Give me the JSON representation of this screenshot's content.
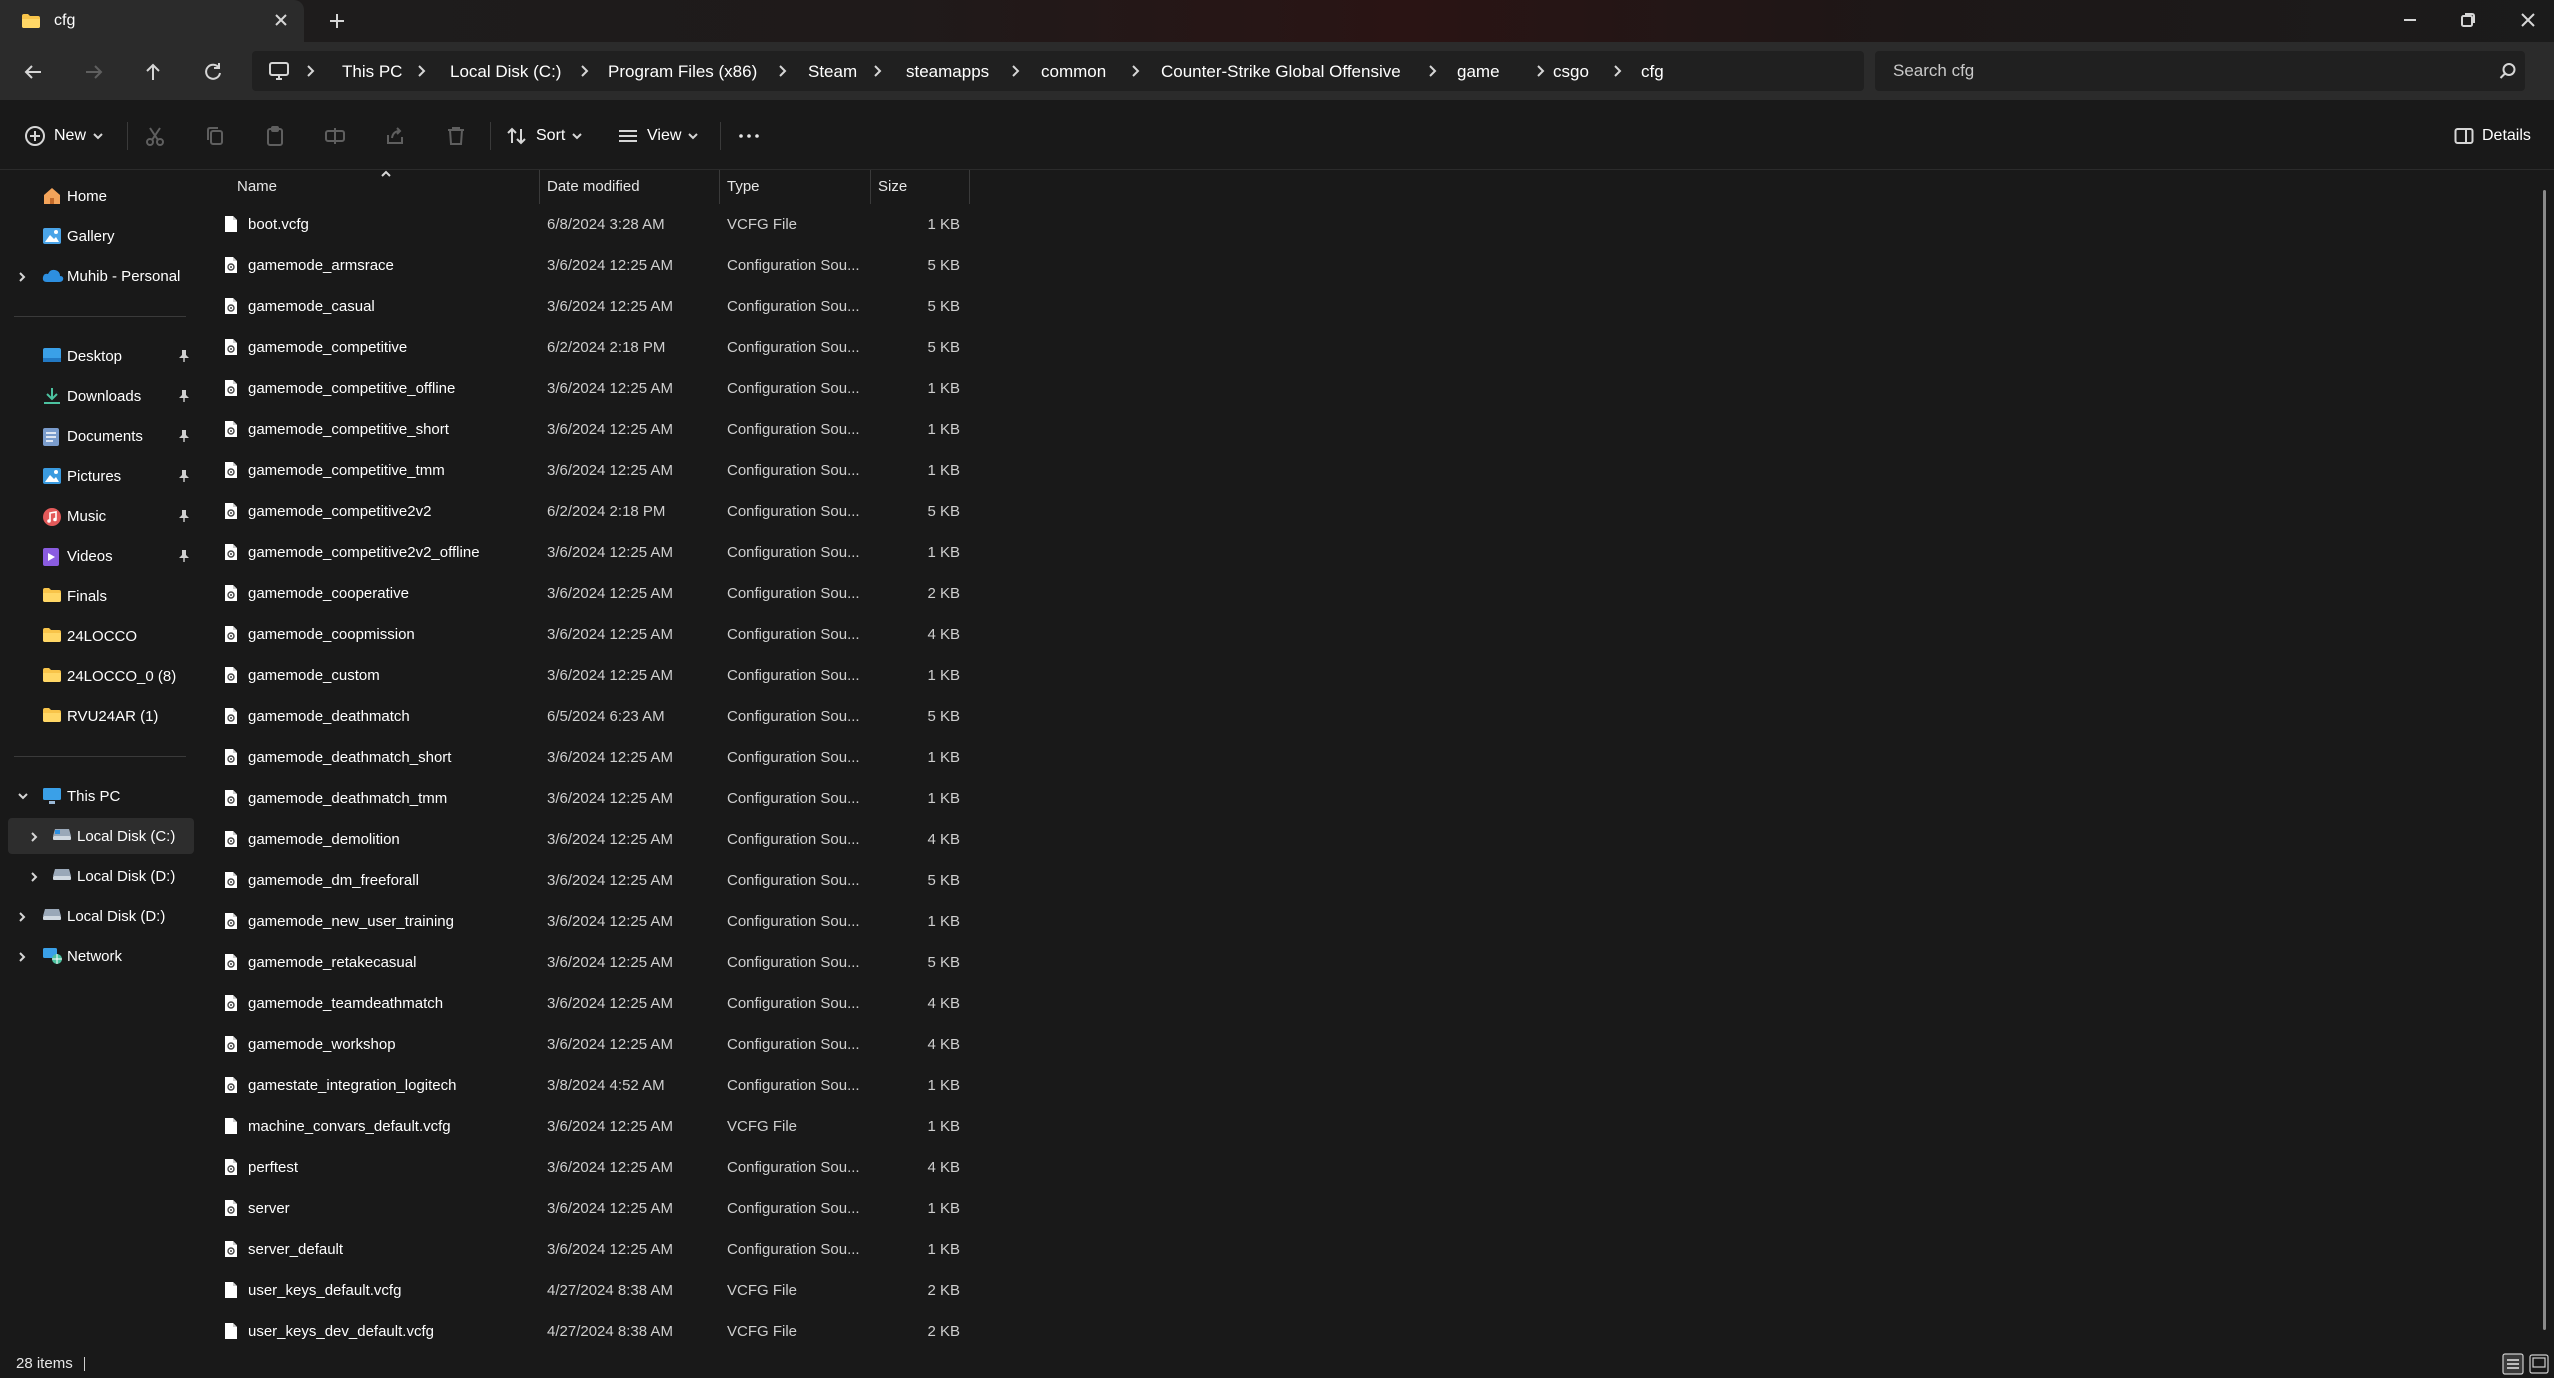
{
  "window": {
    "tab_title": "cfg",
    "tab_icon": "folder-icon",
    "accent_folder": "#f8c44a"
  },
  "address": {
    "crumbs": [
      "This PC",
      "Local Disk (C:)",
      "Program Files (x86)",
      "Steam",
      "steamapps",
      "common",
      "Counter-Strike Global Offensive",
      "game",
      "csgo",
      "cfg"
    ]
  },
  "search": {
    "placeholder": "Search cfg"
  },
  "commandbar": {
    "new_label": "New",
    "sort_label": "Sort",
    "view_label": "View",
    "details_label": "Details"
  },
  "sidebar": {
    "home": "Home",
    "gallery": "Gallery",
    "onedrive": "Muhib - Personal",
    "quick": [
      "Desktop",
      "Downloads",
      "Documents",
      "Pictures",
      "Music",
      "Videos",
      "Finals",
      "24LOCCO",
      "24LOCCO_0 (8)",
      "RVU24AR (1)"
    ],
    "thispc": "This PC",
    "disk_c": "Local Disk (C:)",
    "disk_d_sub": "Local Disk (D:)",
    "disk_d": "Local Disk (D:)",
    "network": "Network"
  },
  "columns": {
    "name": "Name",
    "date": "Date modified",
    "type": "Type",
    "size": "Size"
  },
  "files": [
    {
      "name": "boot.vcfg",
      "date": "6/8/2024 3:28 AM",
      "type": "VCFG File",
      "size": "1 KB",
      "icon": "file-icon"
    },
    {
      "name": "gamemode_armsrace",
      "date": "3/6/2024 12:25 AM",
      "type": "Configuration Sou...",
      "size": "5 KB",
      "icon": "config-file-icon"
    },
    {
      "name": "gamemode_casual",
      "date": "3/6/2024 12:25 AM",
      "type": "Configuration Sou...",
      "size": "5 KB",
      "icon": "config-file-icon"
    },
    {
      "name": "gamemode_competitive",
      "date": "6/2/2024 2:18 PM",
      "type": "Configuration Sou...",
      "size": "5 KB",
      "icon": "config-file-icon"
    },
    {
      "name": "gamemode_competitive_offline",
      "date": "3/6/2024 12:25 AM",
      "type": "Configuration Sou...",
      "size": "1 KB",
      "icon": "config-file-icon"
    },
    {
      "name": "gamemode_competitive_short",
      "date": "3/6/2024 12:25 AM",
      "type": "Configuration Sou...",
      "size": "1 KB",
      "icon": "config-file-icon"
    },
    {
      "name": "gamemode_competitive_tmm",
      "date": "3/6/2024 12:25 AM",
      "type": "Configuration Sou...",
      "size": "1 KB",
      "icon": "config-file-icon"
    },
    {
      "name": "gamemode_competitive2v2",
      "date": "6/2/2024 2:18 PM",
      "type": "Configuration Sou...",
      "size": "5 KB",
      "icon": "config-file-icon"
    },
    {
      "name": "gamemode_competitive2v2_offline",
      "date": "3/6/2024 12:25 AM",
      "type": "Configuration Sou...",
      "size": "1 KB",
      "icon": "config-file-icon"
    },
    {
      "name": "gamemode_cooperative",
      "date": "3/6/2024 12:25 AM",
      "type": "Configuration Sou...",
      "size": "2 KB",
      "icon": "config-file-icon"
    },
    {
      "name": "gamemode_coopmission",
      "date": "3/6/2024 12:25 AM",
      "type": "Configuration Sou...",
      "size": "4 KB",
      "icon": "config-file-icon"
    },
    {
      "name": "gamemode_custom",
      "date": "3/6/2024 12:25 AM",
      "type": "Configuration Sou...",
      "size": "1 KB",
      "icon": "config-file-icon"
    },
    {
      "name": "gamemode_deathmatch",
      "date": "6/5/2024 6:23 AM",
      "type": "Configuration Sou...",
      "size": "5 KB",
      "icon": "config-file-icon"
    },
    {
      "name": "gamemode_deathmatch_short",
      "date": "3/6/2024 12:25 AM",
      "type": "Configuration Sou...",
      "size": "1 KB",
      "icon": "config-file-icon"
    },
    {
      "name": "gamemode_deathmatch_tmm",
      "date": "3/6/2024 12:25 AM",
      "type": "Configuration Sou...",
      "size": "1 KB",
      "icon": "config-file-icon"
    },
    {
      "name": "gamemode_demolition",
      "date": "3/6/2024 12:25 AM",
      "type": "Configuration Sou...",
      "size": "4 KB",
      "icon": "config-file-icon"
    },
    {
      "name": "gamemode_dm_freeforall",
      "date": "3/6/2024 12:25 AM",
      "type": "Configuration Sou...",
      "size": "5 KB",
      "icon": "config-file-icon"
    },
    {
      "name": "gamemode_new_user_training",
      "date": "3/6/2024 12:25 AM",
      "type": "Configuration Sou...",
      "size": "1 KB",
      "icon": "config-file-icon"
    },
    {
      "name": "gamemode_retakecasual",
      "date": "3/6/2024 12:25 AM",
      "type": "Configuration Sou...",
      "size": "5 KB",
      "icon": "config-file-icon"
    },
    {
      "name": "gamemode_teamdeathmatch",
      "date": "3/6/2024 12:25 AM",
      "type": "Configuration Sou...",
      "size": "4 KB",
      "icon": "config-file-icon"
    },
    {
      "name": "gamemode_workshop",
      "date": "3/6/2024 12:25 AM",
      "type": "Configuration Sou...",
      "size": "4 KB",
      "icon": "config-file-icon"
    },
    {
      "name": "gamestate_integration_logitech",
      "date": "3/8/2024 4:52 AM",
      "type": "Configuration Sou...",
      "size": "1 KB",
      "icon": "config-file-icon"
    },
    {
      "name": "machine_convars_default.vcfg",
      "date": "3/6/2024 12:25 AM",
      "type": "VCFG File",
      "size": "1 KB",
      "icon": "file-icon"
    },
    {
      "name": "perftest",
      "date": "3/6/2024 12:25 AM",
      "type": "Configuration Sou...",
      "size": "4 KB",
      "icon": "config-file-icon"
    },
    {
      "name": "server",
      "date": "3/6/2024 12:25 AM",
      "type": "Configuration Sou...",
      "size": "1 KB",
      "icon": "config-file-icon"
    },
    {
      "name": "server_default",
      "date": "3/6/2024 12:25 AM",
      "type": "Configuration Sou...",
      "size": "1 KB",
      "icon": "config-file-icon"
    },
    {
      "name": "user_keys_default.vcfg",
      "date": "4/27/2024 8:38 AM",
      "type": "VCFG File",
      "size": "2 KB",
      "icon": "file-icon"
    },
    {
      "name": "user_keys_dev_default.vcfg",
      "date": "4/27/2024 8:38 AM",
      "type": "VCFG File",
      "size": "2 KB",
      "icon": "file-icon"
    }
  ],
  "status": {
    "count": "28 items"
  }
}
